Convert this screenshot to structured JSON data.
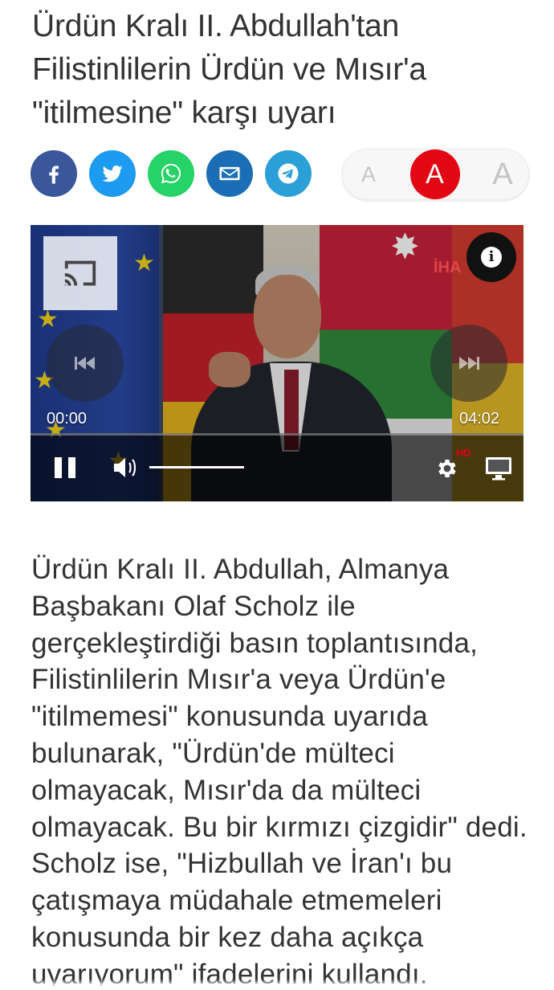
{
  "headline": "Ürdün Kralı II. Abdullah'tan Filistinlilerin Ürdün ve Mısır'a \"itilmesine\" karşı uyarı",
  "share": [
    {
      "name": "facebook",
      "icon": "facebook-icon",
      "color": "#3a579a"
    },
    {
      "name": "twitter",
      "icon": "twitter-icon",
      "color": "#1d9bf0"
    },
    {
      "name": "whatsapp",
      "icon": "whatsapp-icon",
      "color": "#25d366"
    },
    {
      "name": "email",
      "icon": "envelope-icon",
      "color": "#1b6eb5"
    },
    {
      "name": "telegram",
      "icon": "telegram-icon",
      "color": "#2a9fd8"
    }
  ],
  "font_size": {
    "small": "A",
    "medium": "A",
    "large": "A",
    "selected": "medium",
    "accent_color": "#e30613"
  },
  "video": {
    "current_time": "00:00",
    "duration": "04:02",
    "quality_badge": "HD",
    "watermark": "İHA",
    "progress_fraction": 0,
    "volume_fraction": 1
  },
  "article": {
    "body": "Ürdün Kralı II. Abdullah, Almanya Başbakanı Olaf Scholz ile gerçekleştirdiği basın toplantısında, Filistinlilerin Mısır'a veya Ürdün'e \"itilmemesi\" konusunda uyarıda bulunarak, \"Ürdün'de mülteci olmayacak, Mısır'da da mülteci olmayacak. Bu bir kırmızı çizgidir\" dedi. Scholz ise, \"Hizbullah ve İran'ı bu çatışmaya müdahale etmemeleri konusunda bir kez daha açıkça uyarıyorum\" ifadelerini kullandı."
  }
}
